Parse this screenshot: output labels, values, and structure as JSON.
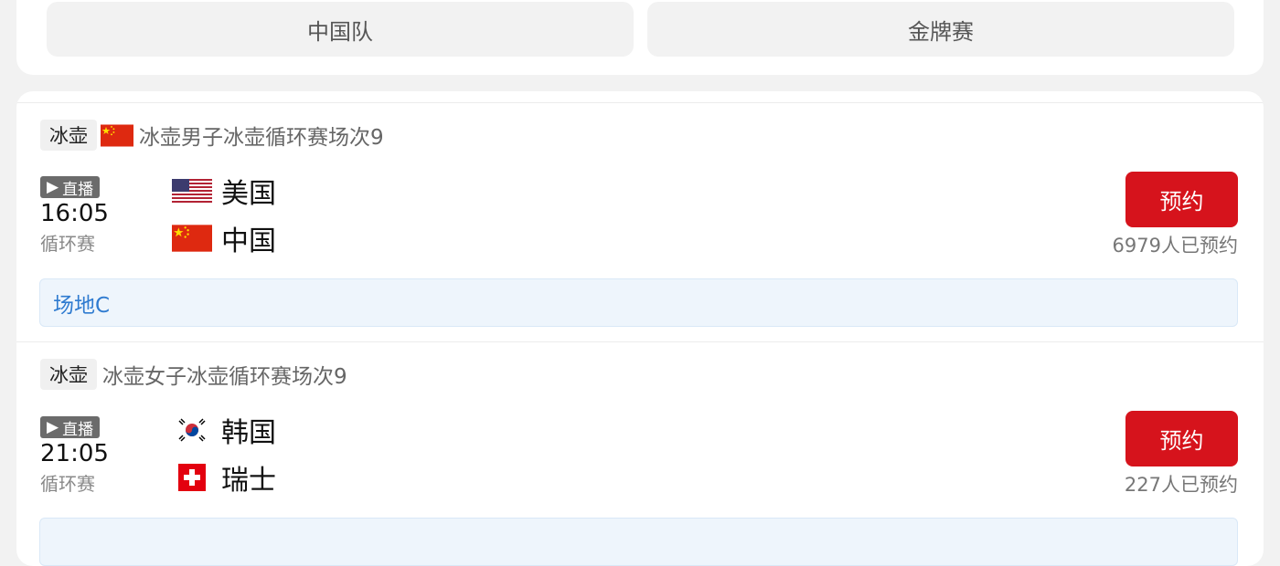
{
  "filters": {
    "team": "中国队",
    "medal": "金牌赛"
  },
  "matches": [
    {
      "sport": "冰壶",
      "title": "冰壶男子冰壶循环赛场次9",
      "live_label": "直播",
      "time": "16:05",
      "stage": "循环赛",
      "team1": "美国",
      "team2": "中国",
      "book_label": "预约",
      "book_count": "6979人已预约",
      "venue": "场地C"
    },
    {
      "sport": "冰壶",
      "title": "冰壶女子冰壶循环赛场次9",
      "live_label": "直播",
      "time": "21:05",
      "stage": "循环赛",
      "team1": "韩国",
      "team2": "瑞士",
      "book_label": "预约",
      "book_count": "227人已预约"
    }
  ],
  "colors": {
    "accent": "#d6131c",
    "venue_text": "#2f7bd0"
  },
  "icons": {
    "live": "play-icon"
  }
}
